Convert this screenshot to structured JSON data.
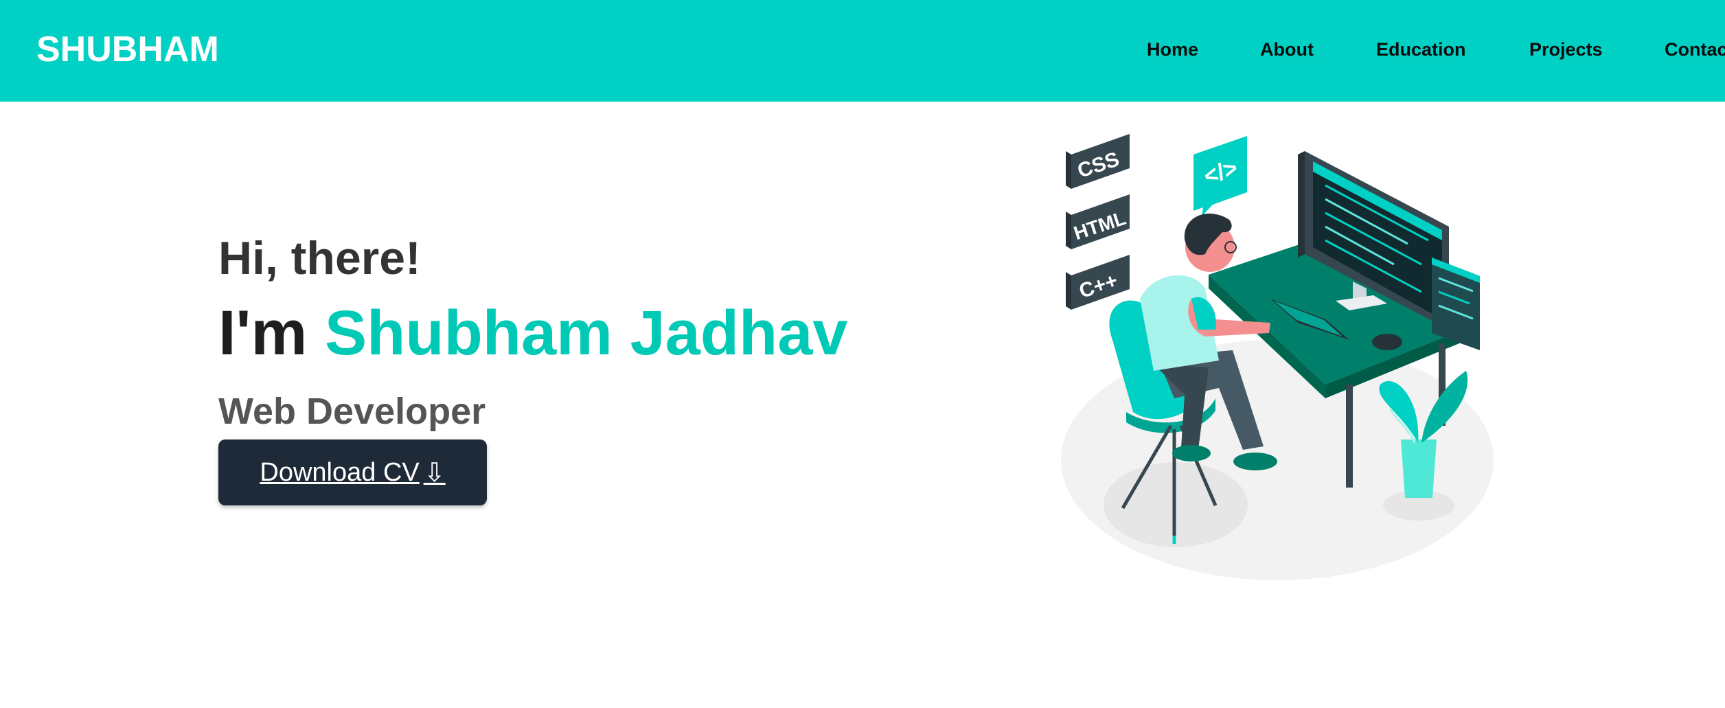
{
  "brand": "SHUBHAM",
  "nav": {
    "items": [
      {
        "label": "Home"
      },
      {
        "label": "About"
      },
      {
        "label": "Education"
      },
      {
        "label": "Projects"
      },
      {
        "label": "Contac"
      }
    ]
  },
  "hero": {
    "greeting": "Hi, there!",
    "name_prefix": "I'm ",
    "name": "Shubham Jadhav",
    "role": "Web Developer",
    "cv_label": "Download CV",
    "cv_icon": "⇩"
  },
  "illustration": {
    "tags": [
      "CSS",
      "HTML",
      "C++"
    ],
    "code_bubble": "</>"
  },
  "colors": {
    "accent": "#00d1c4",
    "name_accent": "#00c9b5",
    "button_bg": "#1e2a38"
  }
}
